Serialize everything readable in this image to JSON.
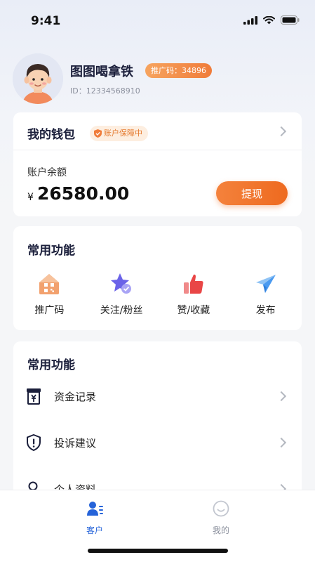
{
  "status_bar": {
    "time": "9:41"
  },
  "profile": {
    "username": "图图喝拿铁",
    "promo_code": "推广码：34896",
    "user_id": "ID：12334568910"
  },
  "wallet": {
    "title": "我的钱包",
    "guard_badge": "账户保障中",
    "balance_label": "账户余额",
    "currency": "¥",
    "balance": "26580.00",
    "withdraw_label": "提现"
  },
  "functions": {
    "title": "常用功能",
    "items": [
      {
        "label": "推广码",
        "icon": "qrcode-house-icon"
      },
      {
        "label": "关注/粉丝",
        "icon": "star-check-icon"
      },
      {
        "label": "赞/收藏",
        "icon": "thumbs-up-icon"
      },
      {
        "label": "发布",
        "icon": "paper-plane-icon"
      }
    ]
  },
  "list_section": {
    "title": "常用功能",
    "rows": [
      {
        "label": "资金记录",
        "icon": "yuan-record-icon"
      },
      {
        "label": "投诉建议",
        "icon": "shield-alert-icon"
      },
      {
        "label": "个人资料",
        "icon": "person-icon"
      }
    ]
  },
  "tabbar": {
    "tabs": [
      {
        "label": "客户",
        "icon": "customers-icon",
        "active": true
      },
      {
        "label": "我的",
        "icon": "smile-icon",
        "active": false
      }
    ]
  },
  "colors": {
    "accent": "#ee6a1f",
    "nav_active": "#2563d9",
    "title": "#1b1f3b"
  }
}
